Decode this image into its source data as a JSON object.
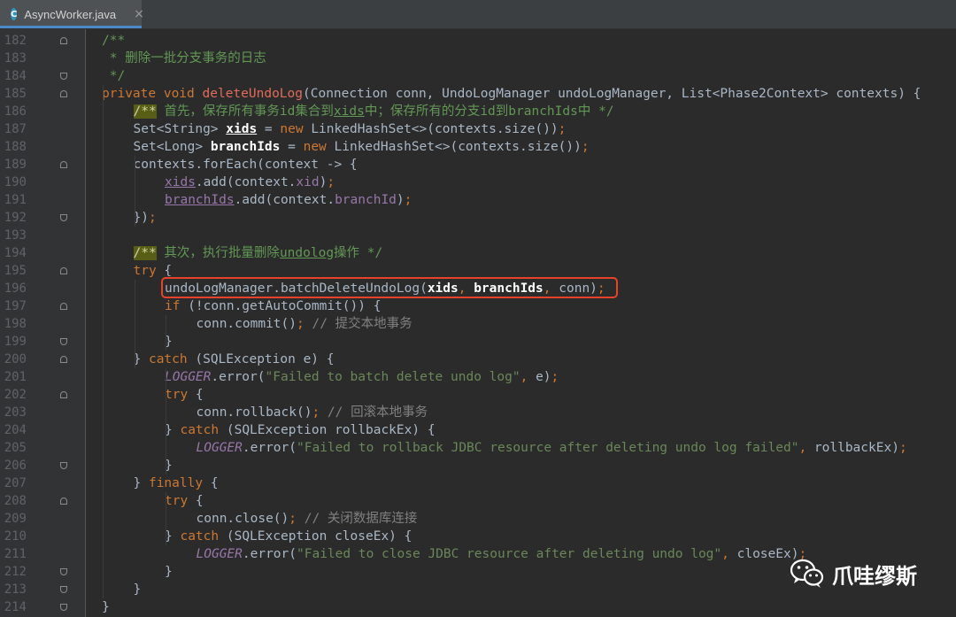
{
  "tab": {
    "icon": "C",
    "filename": "AsyncWorker.java",
    "close": "×"
  },
  "watermark": {
    "text": "爪哇缪斯"
  },
  "highlight": {
    "color": "#e8412c",
    "line": "196"
  },
  "lines": [
    {
      "n": "182",
      "fold": "start",
      "indent": 1,
      "html": "<span class='doc'>/**</span>"
    },
    {
      "n": "183",
      "fold": "",
      "indent": 1,
      "html": "<span class='doc'> * 删除一批分支事务的日志</span>"
    },
    {
      "n": "184",
      "fold": "end",
      "indent": 1,
      "html": "<span class='doc'> */</span>"
    },
    {
      "n": "185",
      "fold": "start",
      "indent": 1,
      "html": "<span class='kw'>private void </span><span class='fnred'>deleteUndoLog</span>(Connection conn, UndoLogManager undoLogManager, List&lt;Phase2Context&gt; contexts) {"
    },
    {
      "n": "186",
      "fold": "",
      "indent": 2,
      "html": "<span class='dockw'>/**</span><span class='doc'> 首先，保存所有事务id集合到<span class='ul'>xids</span>中；保存所有的分支id到branchIds中 */</span>"
    },
    {
      "n": "187",
      "fold": "",
      "indent": 2,
      "html": "Set&lt;String&gt; <span class='bold ul'>xids</span> = <span class='kw'>new </span>LinkedHashSet&lt;&gt;(contexts.size())<span class='kw'>;</span>"
    },
    {
      "n": "188",
      "fold": "",
      "indent": 2,
      "html": "Set&lt;Long&gt; <span class='bold'>branchIds</span> = <span class='kw'>new </span>LinkedHashSet&lt;&gt;(contexts.size())<span class='kw'>;</span>"
    },
    {
      "n": "189",
      "fold": "start",
      "indent": 2,
      "html": "contexts.forEach(context -&gt; {"
    },
    {
      "n": "190",
      "fold": "",
      "indent": 3,
      "html": "<span class='pur ul'>xids</span>.add(context.<span class='fld'>xid</span>)<span class='kw'>;</span>"
    },
    {
      "n": "191",
      "fold": "",
      "indent": 3,
      "html": "<span class='pur ul'>branchIds</span>.add(context.<span class='fld'>branchId</span>)<span class='kw'>;</span>"
    },
    {
      "n": "192",
      "fold": "end",
      "indent": 2,
      "html": "})<span class='kw'>;</span>"
    },
    {
      "n": "193",
      "fold": "",
      "indent": 0,
      "html": ""
    },
    {
      "n": "194",
      "fold": "",
      "indent": 2,
      "html": "<span class='dockw'>/**</span><span class='doc'> 其次，执行批量删除<span class='ul'>undolog</span>操作 */</span>"
    },
    {
      "n": "195",
      "fold": "start",
      "indent": 2,
      "html": "<span class='kw'>try </span>{"
    },
    {
      "n": "196",
      "fold": "",
      "indent": 3,
      "html": "undoLogManager.batchDeleteUndoLog(<span class='bold'>xids</span><span class='kw'>, </span><span class='bold'>branchIds</span><span class='kw'>, </span>conn)<span class='kw'>;</span>"
    },
    {
      "n": "197",
      "fold": "start",
      "indent": 3,
      "html": "<span class='kw'>if </span>(!conn.getAutoCommit()) {"
    },
    {
      "n": "198",
      "fold": "",
      "indent": 4,
      "html": "conn.commit()<span class='kw'>; </span><span class='cm'>// 提交本地事务</span>"
    },
    {
      "n": "199",
      "fold": "end",
      "indent": 3,
      "html": "}"
    },
    {
      "n": "200",
      "fold": "start",
      "indent": 2,
      "html": "} <span class='kw'>catch </span>(SQLException e) {"
    },
    {
      "n": "201",
      "fold": "",
      "indent": 3,
      "html": "<span class='it'>LOGGER</span>.error(<span class='str'>\"Failed to batch delete undo log\"</span><span class='kw'>, </span>e)<span class='kw'>;</span>"
    },
    {
      "n": "202",
      "fold": "start",
      "indent": 3,
      "html": "<span class='kw'>try </span>{"
    },
    {
      "n": "203",
      "fold": "",
      "indent": 4,
      "html": "conn.rollback()<span class='kw'>; </span><span class='cm'>// 回滚本地事务</span>"
    },
    {
      "n": "204",
      "fold": "",
      "indent": 3,
      "html": "} <span class='kw'>catch </span>(SQLException rollbackEx) {"
    },
    {
      "n": "205",
      "fold": "",
      "indent": 4,
      "html": "<span class='it'>LOGGER</span>.error(<span class='str'>\"Failed to rollback JDBC resource after deleting undo log failed\"</span><span class='kw'>, </span>rollbackEx)<span class='kw'>;</span>"
    },
    {
      "n": "206",
      "fold": "end",
      "indent": 3,
      "html": "}"
    },
    {
      "n": "207",
      "fold": "",
      "indent": 2,
      "html": "} <span class='kw'>finally </span>{"
    },
    {
      "n": "208",
      "fold": "start",
      "indent": 3,
      "html": "<span class='kw'>try </span>{"
    },
    {
      "n": "209",
      "fold": "",
      "indent": 4,
      "html": "conn.close()<span class='kw'>; </span><span class='cm'>// 关闭数据库连接</span>"
    },
    {
      "n": "210",
      "fold": "",
      "indent": 3,
      "html": "} <span class='kw'>catch </span>(SQLException closeEx) {"
    },
    {
      "n": "211",
      "fold": "",
      "indent": 4,
      "html": "<span class='it'>LOGGER</span>.error(<span class='str'>\"Failed to close JDBC resource after deleting undo log\"</span><span class='kw'>, </span>closeEx)<span class='kw'>;</span>"
    },
    {
      "n": "212",
      "fold": "end",
      "indent": 3,
      "html": "}"
    },
    {
      "n": "213",
      "fold": "end",
      "indent": 2,
      "html": "}"
    },
    {
      "n": "214",
      "fold": "end",
      "indent": 1,
      "html": "}"
    }
  ]
}
